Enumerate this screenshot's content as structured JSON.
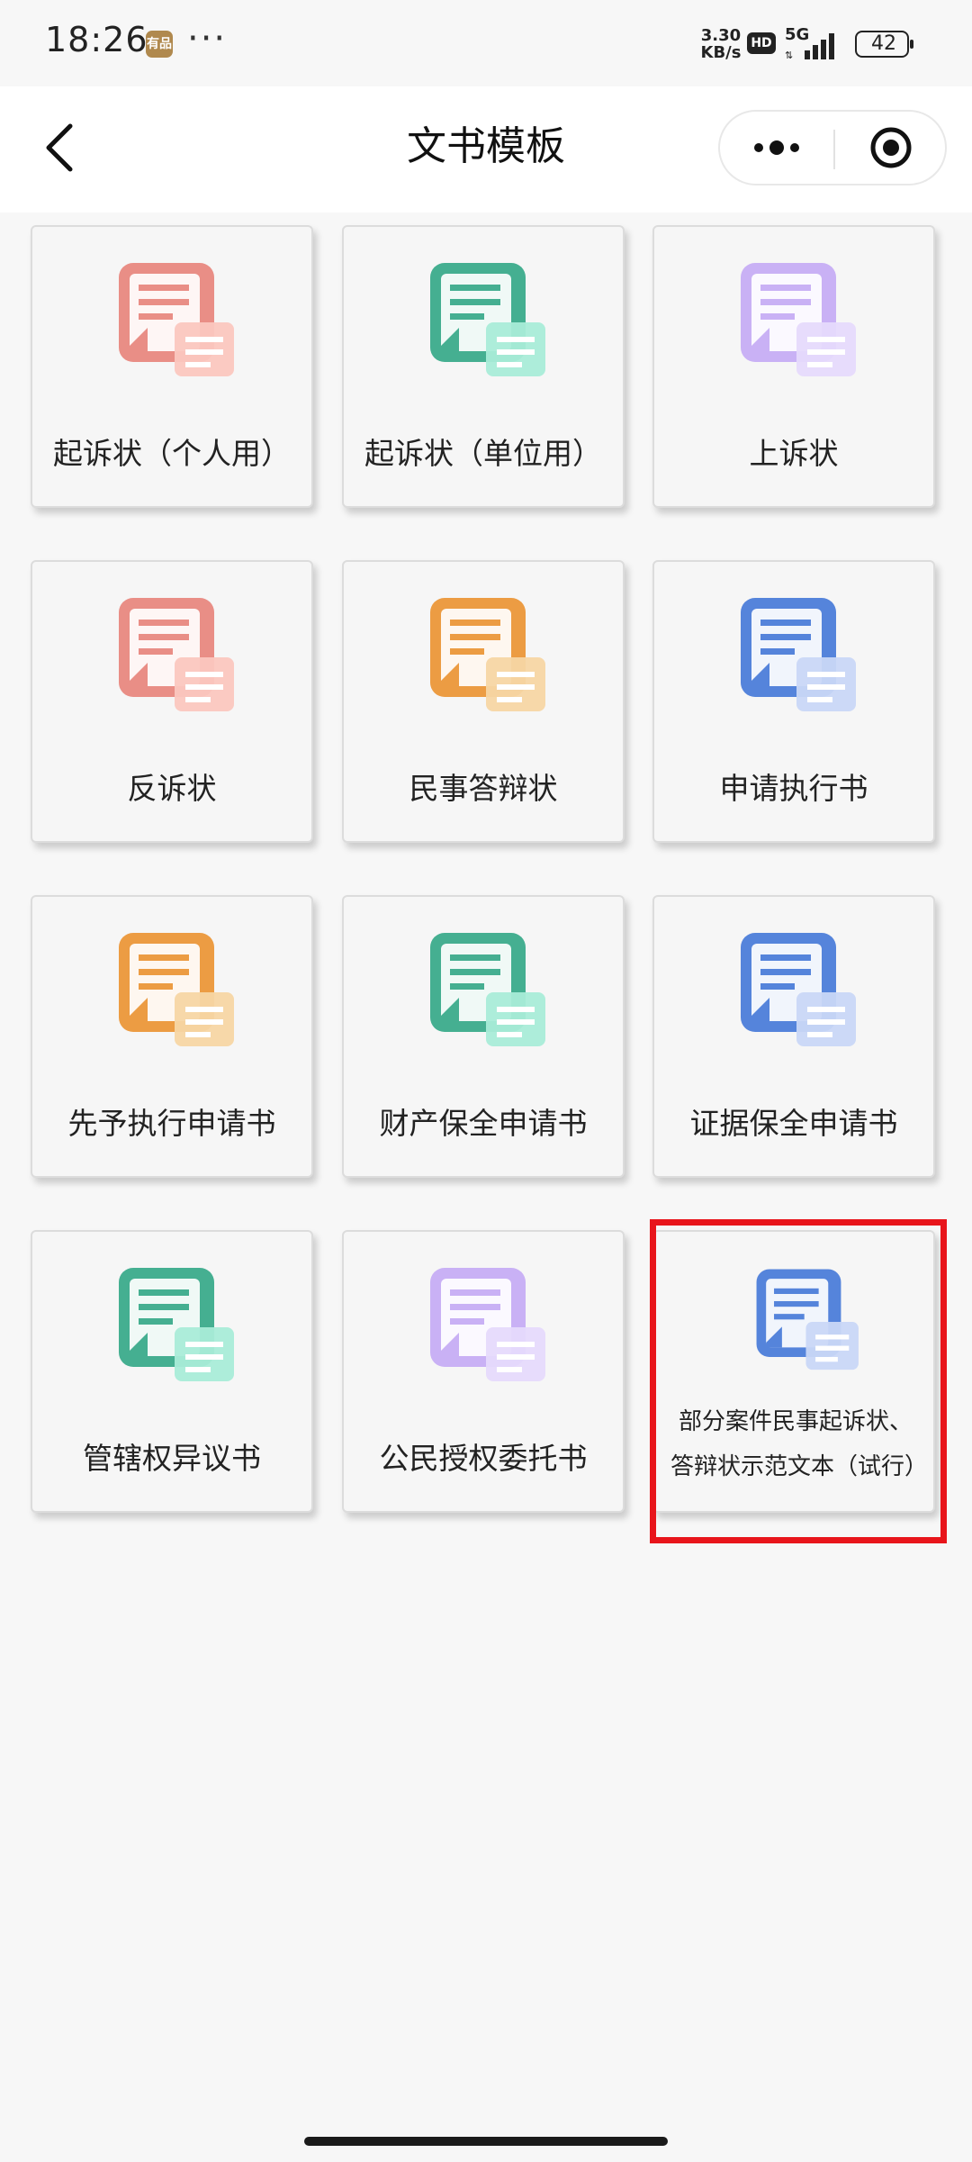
{
  "status_bar": {
    "time": "18:26",
    "app_badge": "有品",
    "more_dots": "···",
    "net_speed_value": "3.30",
    "net_speed_unit": "KB/s",
    "hd": "HD",
    "network": "5G",
    "battery": "42"
  },
  "nav": {
    "title": "文书模板"
  },
  "colors": {
    "red": "#e98e86",
    "green": "#45af91",
    "purple": "#c9b1f5",
    "orange": "#ec9c43",
    "blue": "#5584db",
    "highlight": "#e8151b"
  },
  "cards": [
    {
      "label": "起诉状（个人用）",
      "color": "red",
      "icon": "person-doc-icon"
    },
    {
      "label": "起诉状（单位用）",
      "color": "green",
      "icon": "building-doc-icon"
    },
    {
      "label": "上诉状",
      "color": "purple",
      "icon": "scales-doc-icon"
    },
    {
      "label": "反诉状",
      "color": "red",
      "icon": "calendar-return-doc-icon"
    },
    {
      "label": "民事答辩状",
      "color": "orange",
      "icon": "chat-doc-icon"
    },
    {
      "label": "申请执行书",
      "color": "blue",
      "icon": "gavel-doc-icon"
    },
    {
      "label": "先予执行申请书",
      "color": "orange",
      "icon": "forward-doc-icon"
    },
    {
      "label": "财产保全申请书",
      "color": "green",
      "icon": "money-bag-doc-icon"
    },
    {
      "label": "证据保全申请书",
      "color": "blue",
      "icon": "paper-doc-icon"
    },
    {
      "label": "管辖权异议书",
      "color": "green",
      "icon": "list-doc-icon"
    },
    {
      "label": "公民授权委托书",
      "color": "purple",
      "icon": "transfer-doc-icon"
    },
    {
      "label": "部分案件民事起诉状、答辩状示范文本（试行）",
      "color": "blue",
      "icon": "sample-doc-icon"
    }
  ]
}
